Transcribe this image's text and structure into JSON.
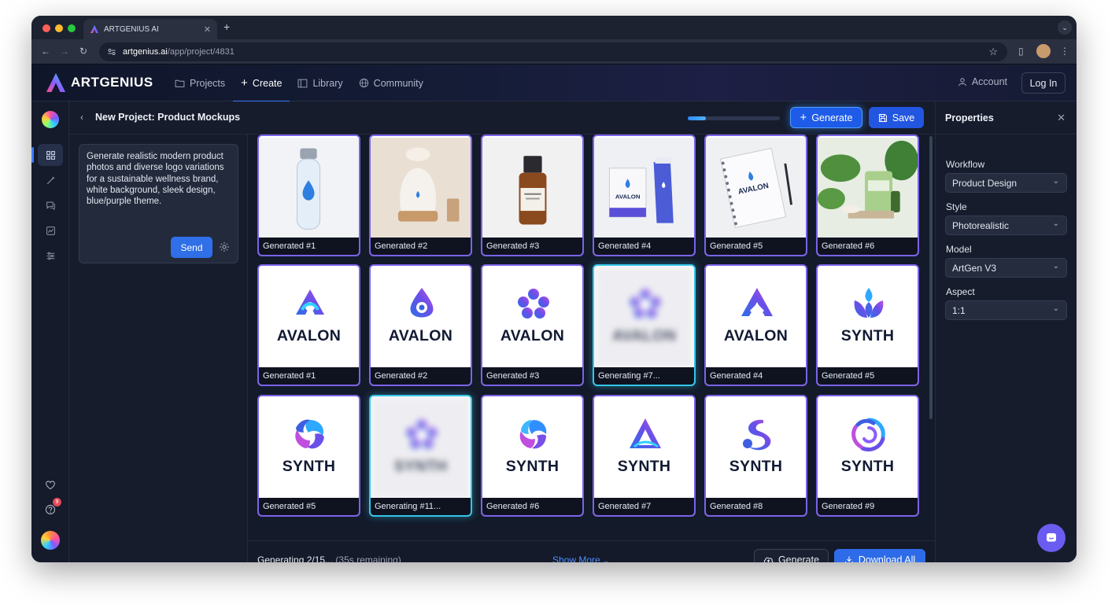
{
  "browser": {
    "tab_title": "ARTGENIUS AI",
    "url_host": "artgenius.ai",
    "url_path": "/app/project/4831"
  },
  "header": {
    "brand": "ARTGENIUS",
    "nav": [
      {
        "label": "Projects",
        "icon": "folder-icon"
      },
      {
        "label": "Create",
        "icon": "plus-icon"
      },
      {
        "label": "Library",
        "icon": "library-icon"
      },
      {
        "label": "Community",
        "icon": "globe-icon"
      }
    ],
    "active_nav": "Create",
    "account_label": "Account",
    "login_label": "Log In"
  },
  "rail": {
    "items": [
      "grid-icon",
      "magic-wand-icon",
      "chat-icon",
      "chart-icon",
      "sliders-icon"
    ],
    "bottom": [
      "heart-icon",
      "help-icon"
    ],
    "help_badge": "9"
  },
  "project": {
    "title": "New Project: Product Mockups",
    "progress": 0.2,
    "generate_label": "Generate",
    "save_label": "Save"
  },
  "prompt": {
    "text": "Generate realistic modern product photos and diverse logo variations for a sustainable wellness brand, white background, sleek design, blue/purple theme.",
    "send_label": "Send"
  },
  "grid": {
    "rows": [
      [
        {
          "caption": "Generated #1",
          "kind": "bottle"
        },
        {
          "caption": "Generated #2",
          "kind": "diffuser"
        },
        {
          "caption": "Generated #3",
          "kind": "dropper"
        },
        {
          "caption": "Generated #4",
          "kind": "box",
          "text": "AVALON"
        },
        {
          "caption": "Generated #5",
          "kind": "notebook",
          "text": "AVALON"
        },
        {
          "caption": "Generated #6",
          "kind": "plants"
        }
      ],
      [
        {
          "caption": "Generated #1",
          "kind": "logo",
          "mark": "knot",
          "text": "AVALON"
        },
        {
          "caption": "Generated #2",
          "kind": "logo",
          "mark": "drop",
          "text": "AVALON"
        },
        {
          "caption": "Generated #3",
          "kind": "logo",
          "mark": "flower",
          "text": "AVALON"
        },
        {
          "caption": "Generating #7...",
          "kind": "pending",
          "text": "AVALON"
        },
        {
          "caption": "Generated #4",
          "kind": "logo",
          "mark": "peak",
          "text": "AVALON"
        },
        {
          "caption": "Generated #5",
          "kind": "logo",
          "mark": "lotus",
          "text": "SYNTH"
        }
      ],
      [
        {
          "caption": "Generated #5",
          "kind": "logo",
          "mark": "swirl",
          "text": "SYNTH"
        },
        {
          "caption": "Generating #11...",
          "kind": "pending",
          "text": "SYNTH"
        },
        {
          "caption": "Generated #6",
          "kind": "logo",
          "mark": "swirl2",
          "text": "SYNTH"
        },
        {
          "caption": "Generated #7",
          "kind": "logo",
          "mark": "triangle",
          "text": "SYNTH"
        },
        {
          "caption": "Generated #8",
          "kind": "logo",
          "mark": "s",
          "text": "SYNTH"
        },
        {
          "caption": "Generated #9",
          "kind": "logo",
          "mark": "spiral",
          "text": "SYNTH"
        }
      ]
    ]
  },
  "footer": {
    "status": "Generating 2/15...",
    "remaining": "(35s remaining)",
    "show_more": "Show More",
    "generate_label": "Generate",
    "download_label": "Download All"
  },
  "properties": {
    "title": "Properties",
    "fields": [
      {
        "label": "Workflow",
        "value": "Product Design"
      },
      {
        "label": "Style",
        "value": "Photorealistic"
      },
      {
        "label": "Model",
        "value": "ArtGen V3"
      },
      {
        "label": "Aspect",
        "value": "1:1"
      }
    ]
  },
  "colors": {
    "accent": "#2e6be8",
    "card_border": "#7b63e8",
    "pending_border": "#35c6e8",
    "background": "#141a2a"
  }
}
